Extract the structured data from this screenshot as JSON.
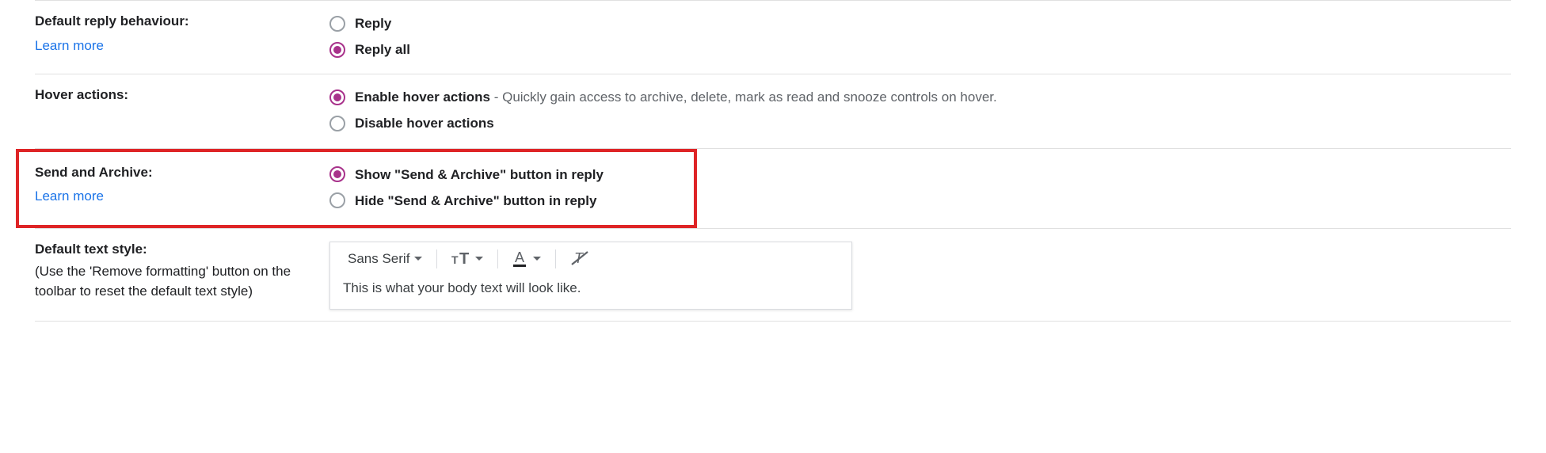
{
  "reply": {
    "title": "Default reply behaviour:",
    "learn": "Learn more",
    "opt1": "Reply",
    "opt2": "Reply all"
  },
  "hover": {
    "title": "Hover actions:",
    "opt1": "Enable hover actions",
    "opt1_desc": " - Quickly gain access to archive, delete, mark as read and snooze controls on hover.",
    "opt2": "Disable hover actions"
  },
  "archive": {
    "title": "Send and Archive:",
    "learn": "Learn more",
    "opt1": "Show \"Send & Archive\" button in reply",
    "opt2": "Hide \"Send & Archive\" button in reply"
  },
  "textstyle": {
    "title": "Default text style:",
    "hint": "(Use the 'Remove formatting' button on the toolbar to reset the default text style)",
    "font": "Sans Serif",
    "preview": "This is what your body text will look like."
  }
}
